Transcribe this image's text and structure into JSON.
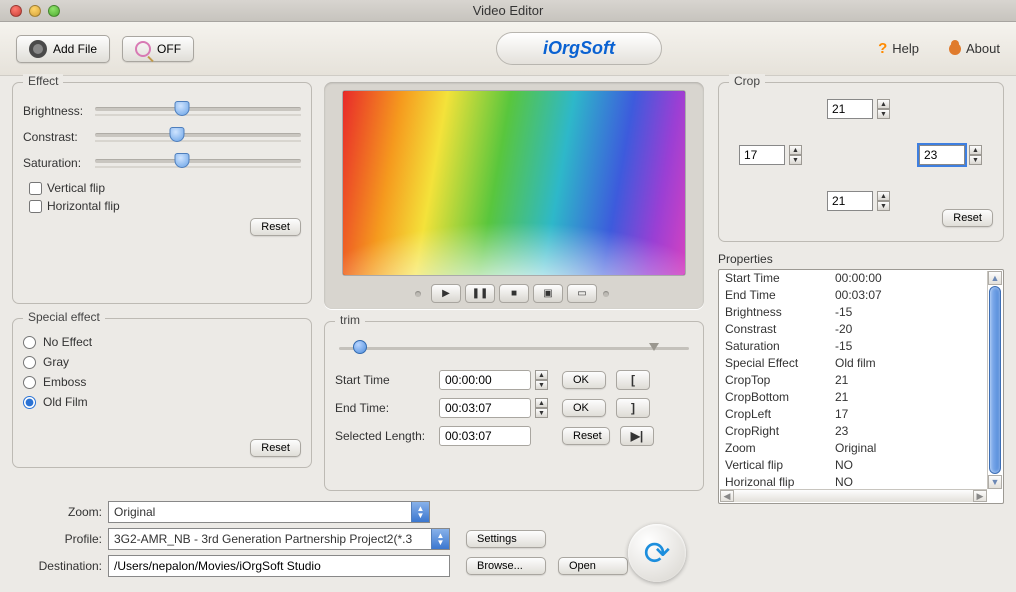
{
  "window": {
    "title": "Video Editor"
  },
  "toolbar": {
    "add_file_label": "Add File",
    "off_label": "OFF",
    "logo_text": "iOrgSoft",
    "help_label": "Help",
    "about_label": "About"
  },
  "effect": {
    "legend": "Effect",
    "brightness_label": "Brightness:",
    "contrast_label": "Constrast:",
    "saturation_label": "Saturation:",
    "brightness_pos_pct": 42,
    "contrast_pos_pct": 40,
    "saturation_pos_pct": 42,
    "vertical_flip_label": "Vertical flip",
    "horizontal_flip_label": "Horizontal flip",
    "vertical_flip_checked": false,
    "horizontal_flip_checked": false,
    "reset_label": "Reset"
  },
  "special": {
    "legend": "Special effect",
    "options": [
      "No Effect",
      "Gray",
      "Emboss",
      "Old Film"
    ],
    "selected_index": 3,
    "reset_label": "Reset"
  },
  "transport": {
    "play": "▶",
    "pause": "❚❚",
    "stop": "■",
    "snapshot": "▣",
    "fullscreen": "▭"
  },
  "trim": {
    "legend": "trim",
    "thumb_pos_pct": 6,
    "end_tri_pct": 90,
    "start_time_label": "Start Time",
    "end_time_label": "End Time:",
    "selected_len_label": "Selected Length:",
    "start_time_value": "00:00:00",
    "end_time_value": "00:03:07",
    "selected_len_value": "00:03:07",
    "ok_label": "OK",
    "reset_label": "Reset",
    "mark_in": "[",
    "mark_out": "]",
    "play_sel": "▶|"
  },
  "crop": {
    "legend": "Crop",
    "top": "21",
    "left": "17",
    "right": "23",
    "bottom": "21",
    "reset_label": "Reset"
  },
  "properties": {
    "legend": "Properties",
    "rows": [
      [
        "Start Time",
        "00:00:00"
      ],
      [
        "End Time",
        "00:03:07"
      ],
      [
        "Brightness",
        "-15"
      ],
      [
        "Constrast",
        "-20"
      ],
      [
        "Saturation",
        "-15"
      ],
      [
        "Special Effect",
        "Old film"
      ],
      [
        "CropTop",
        "21"
      ],
      [
        "CropBottom",
        "21"
      ],
      [
        "CropLeft",
        "17"
      ],
      [
        "CropRight",
        "23"
      ],
      [
        "Zoom",
        "Original"
      ],
      [
        "Vertical flip",
        "NO"
      ],
      [
        "Horizonal flip",
        "NO"
      ]
    ]
  },
  "bottom": {
    "zoom_label": "Zoom:",
    "zoom_value": "Original",
    "profile_label": "Profile:",
    "profile_value": "3G2-AMR_NB - 3rd Generation Partnership Project2(*.3",
    "destination_label": "Destination:",
    "destination_value": "/Users/nepalon/Movies/iOrgSoft Studio",
    "settings_label": "Settings",
    "browse_label": "Browse...",
    "open_label": "Open"
  }
}
